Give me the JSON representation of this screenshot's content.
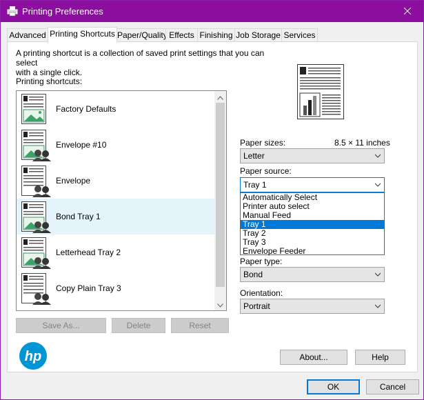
{
  "window": {
    "title": "Printing Preferences"
  },
  "tabs": [
    {
      "label": "Advanced"
    },
    {
      "label": "Printing Shortcuts"
    },
    {
      "label": "Paper/Quality"
    },
    {
      "label": "Effects"
    },
    {
      "label": "Finishing"
    },
    {
      "label": "Job Storage"
    },
    {
      "label": "Services"
    }
  ],
  "intro": {
    "line1": "A printing shortcut is a collection of saved print settings that you can select",
    "line2": "with a single click."
  },
  "shortcuts": {
    "label": "Printing shortcuts:",
    "items": [
      {
        "name": "Factory Defaults",
        "icon": "document-landscape-icon"
      },
      {
        "name": "Envelope #10",
        "icon": "document-users-icon"
      },
      {
        "name": "Envelope",
        "icon": "document-users-icon"
      },
      {
        "name": "Bond Tray 1",
        "icon": "document-users-icon",
        "selected": true
      },
      {
        "name": "Letterhead Tray 2",
        "icon": "document-users-icon"
      },
      {
        "name": "Copy Plain Tray 3",
        "icon": "document-users-icon"
      }
    ],
    "buttons": {
      "save_as": "Save As...",
      "delete": "Delete",
      "reset": "Reset"
    }
  },
  "paper_sizes": {
    "label": "Paper sizes:",
    "dimension": "8.5 × 11 inches",
    "value": "Letter"
  },
  "paper_source": {
    "label": "Paper source:",
    "value": "Tray 1",
    "options": [
      "Automatically Select",
      "Printer auto select",
      "Manual Feed",
      "Tray 1",
      "Tray 2",
      "Tray 3",
      "Envelope Feeder"
    ],
    "selected_index": 3
  },
  "paper_type": {
    "label": "Paper type:",
    "value": "Bond"
  },
  "orientation": {
    "label": "Orientation:",
    "value": "Portrait"
  },
  "footer": {
    "about": "About...",
    "help": "Help",
    "ok": "OK",
    "cancel": "Cancel"
  },
  "colors": {
    "title_bar": "#8c0e9e",
    "accent": "#0078d7",
    "hp_blue": "#0096d6"
  }
}
